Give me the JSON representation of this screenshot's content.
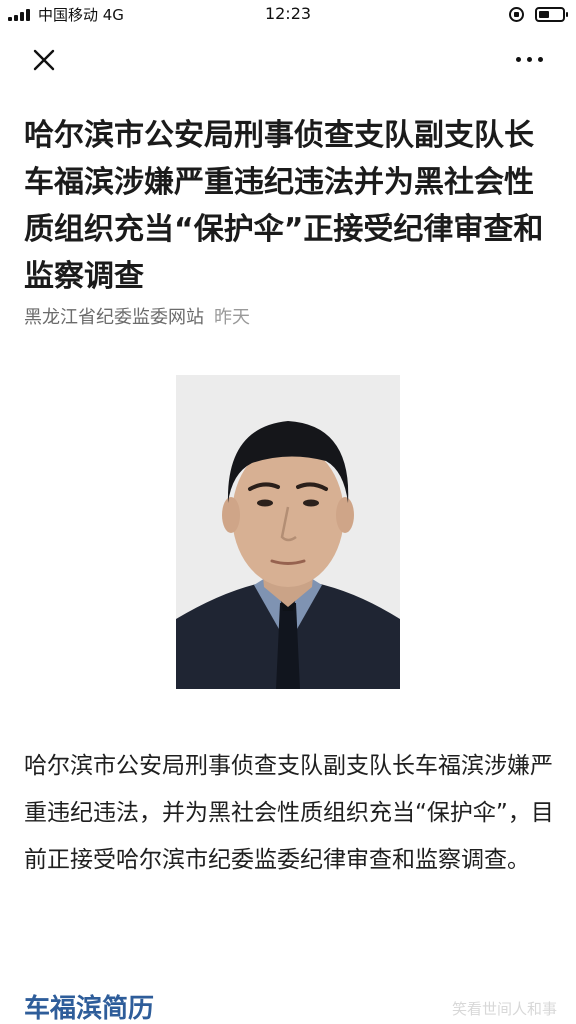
{
  "status_bar": {
    "carrier": "中国移动 4G",
    "time": "12:23"
  },
  "icons": {
    "signal": "signal-icon",
    "orientation_lock": "orientation-lock-icon",
    "battery": "battery-icon",
    "close": "close-icon",
    "more": "more-icon"
  },
  "article": {
    "title": "哈尔滨市公安局刑事侦查支队副支队长车福滨涉嫌严重违纪违法并为黑社会性质组织充当“保护伞”正接受纪律审查和监察调查",
    "source": "黑龙江省纪委监委网站",
    "date": "昨天",
    "body": "哈尔滨市公安局刑事侦查支队副支队长车福滨涉嫌严重违纪违法，并为黑社会性质组织充当“保护伞”，目前正接受哈尔滨市纪委监委纪律审查和监察调查。",
    "section_heading": "车福滨简历"
  },
  "watermark": "笑看世间人和事",
  "colors": {
    "section_heading": "#2e5d9a",
    "meta_text": "#6b6b6b",
    "photo_background": "#ececec",
    "uniform": "#1f2533",
    "shirt": "#7f93b2"
  }
}
